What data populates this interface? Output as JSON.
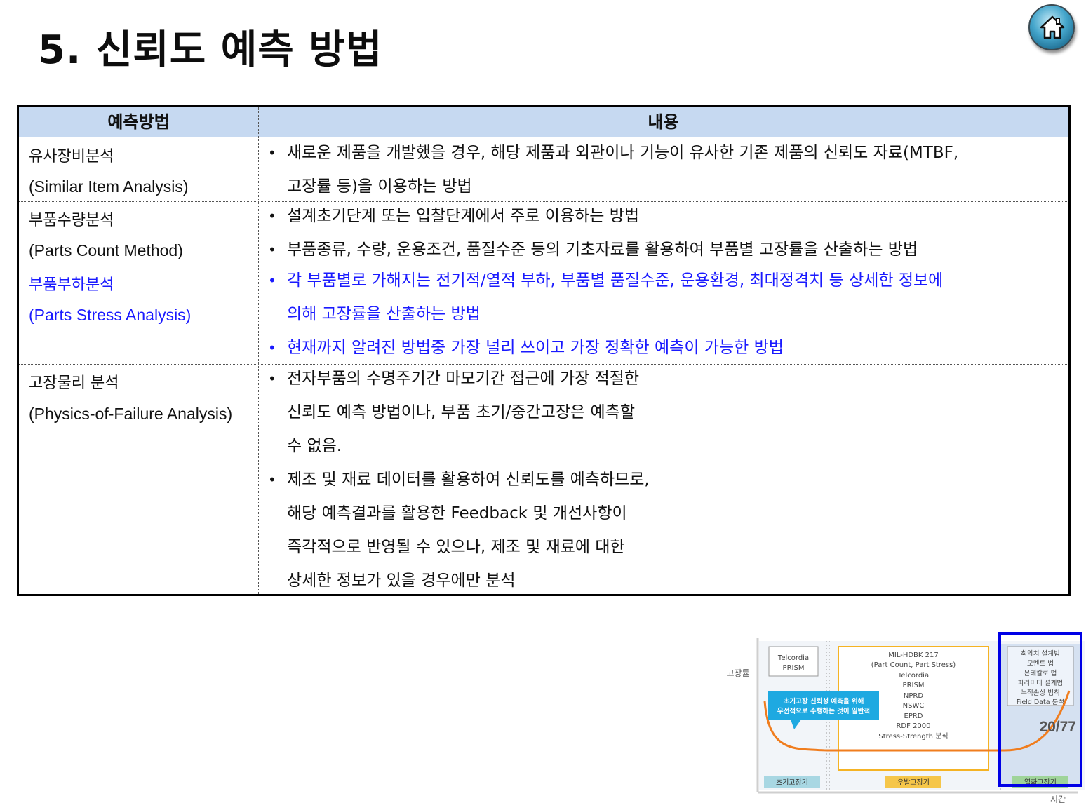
{
  "title": "5. 신뢰도 예측 방법",
  "table": {
    "headers": [
      "예측방법",
      "내용"
    ],
    "rows": [
      {
        "method_ko": "유사장비분석",
        "method_en": "(Similar Item Analysis)",
        "bullets": [
          "새로운 제품을 개발했을 경우, 해당 제품과 외관이나 기능이 유사한 기존 제품의 신뢰도 자료(MTBF,",
          "고장률 등)을 이용하는 방법"
        ]
      },
      {
        "method_ko": "부품수량분석",
        "method_en": "(Parts Count Method)",
        "bullets": [
          "설계초기단계 또는 입찰단계에서 주로 이용하는 방법",
          "부품종류, 수량, 운용조건, 품질수준 등의 기초자료를 활용하여 부품별 고장률을 산출하는 방법"
        ]
      },
      {
        "method_ko": "부품부하분석",
        "method_en": "(Parts Stress Analysis)",
        "bullets": [
          "각 부품별로 가해지는 전기적/열적 부하, 부품별 품질수준, 운용환경, 최대정격치 등 상세한 정보에",
          "의해 고장률을 산출하는 방법",
          "현재까지 알려진 방법중 가장 널리 쓰이고 가장 정확한 예측이 가능한 방법"
        ]
      },
      {
        "method_ko": "고장물리 분석",
        "method_en": "(Physics-of-Failure Analysis)",
        "bullets": [
          "전자부품의 수명주기간 마모기간 접근에 가장 적절한",
          "신뢰도 예측 방법이나, 부품 초기/중간고장은 예측할",
          "수 없음.",
          "제조 및 재료 데이터를 활용하여 신뢰도를 예측하므로,",
          "해당 예측결과를 활용한 Feedback 및 개선사항이",
          "즉각적으로 반영될 수 있으나, 제조 및 재료에 대한",
          "상세한 정보가 있을 경우에만 분석"
        ]
      }
    ]
  },
  "diagram": {
    "ylabel": "고장률",
    "xlabel": "시간",
    "early_box": [
      "Telcordia",
      "PRISM"
    ],
    "random_box": [
      "MIL-HDBK 217",
      "(Part Count, Part Stress)",
      "Telcordia",
      "PRISM",
      "NPRD",
      "NSWC",
      "EPRD",
      "RDF 2000",
      "Stress-Strength 분석"
    ],
    "wearout_box": [
      "최악치 설계법",
      "모멘트 법",
      "몬테칼로 법",
      "파라미터 설계법",
      "누적손상 법칙",
      "Field Data 분석"
    ],
    "callout": [
      "초기고장 신뢰성 예측을 위해",
      "우선적으로 수행하는 것이 일반적"
    ],
    "phase_labels": [
      "초기고장기",
      "우발고장기",
      "열화고장기"
    ],
    "colors": {
      "curve": "#f07d1e",
      "callout": "#1ea9e1",
      "highlight": "#0000e6",
      "random_border": "#f5b324"
    }
  },
  "page": "20/77"
}
